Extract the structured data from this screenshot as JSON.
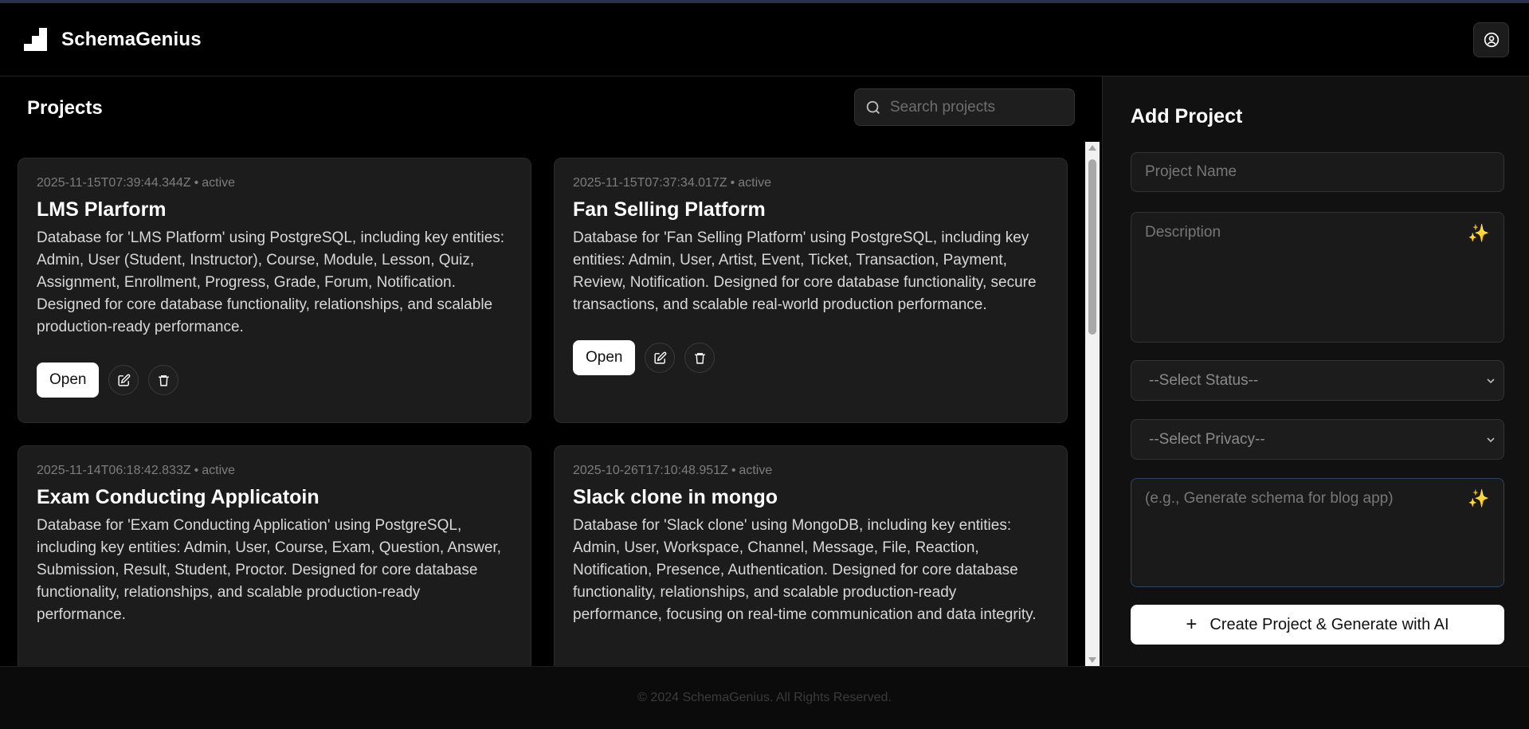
{
  "header": {
    "brand": "SchemaGenius",
    "user_icon": "user-circle-icon",
    "logo_icon": "stairs-logo-icon"
  },
  "projects": {
    "title": "Projects",
    "search_placeholder": "Search projects",
    "open_label": "Open",
    "items": [
      {
        "date": "2025-11-15T07:39:44.344Z",
        "status": "active",
        "name": "LMS Plarform",
        "description": "Database for 'LMS Platform' using PostgreSQL, including key entities: Admin, User (Student, Instructor), Course, Module, Lesson, Quiz, Assignment, Enrollment, Progress, Grade, Forum, Notification. Designed for core database functionality, relationships, and scalable production-ready performance."
      },
      {
        "date": "2025-11-15T07:37:34.017Z",
        "status": "active",
        "name": "Fan Selling Platform",
        "description": "Database for 'Fan Selling Platform' using PostgreSQL, including key entities: Admin, User, Artist, Event, Ticket, Transaction, Payment, Review, Notification. Designed for core database functionality, secure transactions, and scalable real-world production performance."
      },
      {
        "date": "2025-11-14T06:18:42.833Z",
        "status": "active",
        "name": "Exam Conducting Applicatoin",
        "description": "Database for 'Exam Conducting Application' using PostgreSQL, including key entities: Admin, User, Course, Exam, Question, Answer, Submission, Result, Student, Proctor. Designed for core database functionality, relationships, and scalable production-ready performance."
      },
      {
        "date": "2025-10-26T17:10:48.951Z",
        "status": "active",
        "name": "Slack clone in mongo",
        "description": "Database for 'Slack clone' using MongoDB, including key entities: Admin, User, Workspace, Channel, Message, File, Reaction, Notification, Presence, Authentication. Designed for core database functionality, relationships, and scalable production-ready performance, focusing on real-time communication and data integrity."
      }
    ]
  },
  "add_project": {
    "title": "Add Project",
    "name_placeholder": "Project Name",
    "description_placeholder": "Description",
    "status_select": "--Select Status--",
    "privacy_select": "--Select Privacy--",
    "prompt_placeholder": "(e.g., Generate schema for blog app)",
    "create_label": "Create Project & Generate with AI",
    "create_icon": "plus-icon",
    "sparkle_icon": "sparkles-icon"
  },
  "footer": {
    "text": "© 2024 SchemaGenius. All Rights Reserved."
  },
  "colors": {
    "background": "#000000",
    "card": "#1c1c1c",
    "panel": "#111111",
    "accent_sparkle": "#f6c84c",
    "button_primary": "#ffffff"
  }
}
